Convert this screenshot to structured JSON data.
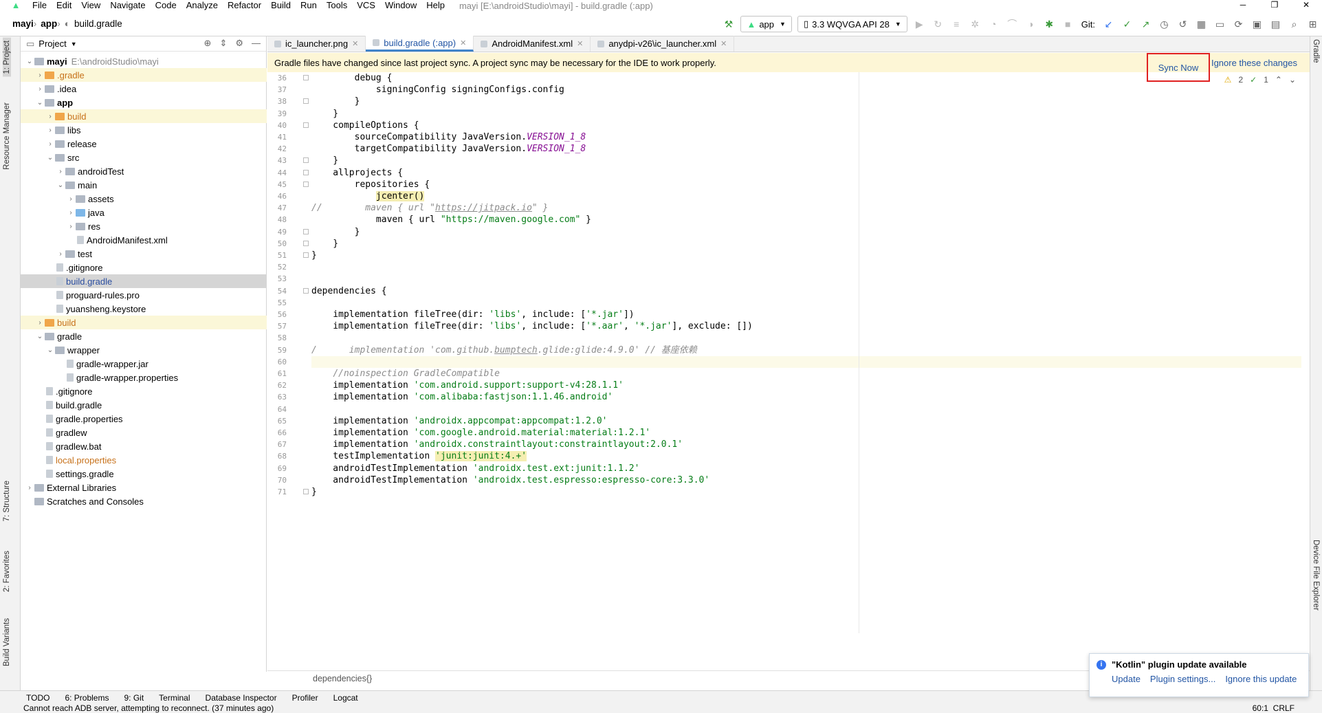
{
  "menu": {
    "items": [
      "File",
      "Edit",
      "View",
      "Navigate",
      "Code",
      "Analyze",
      "Refactor",
      "Build",
      "Run",
      "Tools",
      "VCS",
      "Window",
      "Help"
    ],
    "window_title": "mayi [E:\\androidStudio\\mayi] - build.gradle (:app)"
  },
  "breadcrumb": {
    "project": "mayi",
    "module": "app",
    "file": "build.gradle"
  },
  "toolbar": {
    "config": "app",
    "device": "3.3  WQVGA API 28",
    "git": "Git:"
  },
  "left_tabs": [
    "1: Project",
    "Resource Manager",
    "7: Structure",
    "2: Favorites",
    "Build Variants"
  ],
  "right_tabs": [
    "Gradle",
    "Device File Explorer"
  ],
  "project_panel": {
    "title": "Project"
  },
  "tree": [
    {
      "label": "mayi",
      "sec": "E:\\androidStudio\\mayi",
      "depth": 0,
      "arrow": "v",
      "icon": "fold",
      "bold": true
    },
    {
      "label": ".gradle",
      "depth": 1,
      "arrow": ">",
      "icon": "foldo",
      "cls": "orange",
      "hl": true
    },
    {
      "label": ".idea",
      "depth": 1,
      "arrow": ">",
      "icon": "fold"
    },
    {
      "label": "app",
      "depth": 1,
      "arrow": "v",
      "icon": "fold",
      "bold": true
    },
    {
      "label": "build",
      "depth": 2,
      "arrow": ">",
      "icon": "foldo",
      "cls": "orange",
      "hl": true
    },
    {
      "label": "libs",
      "depth": 2,
      "arrow": ">",
      "icon": "fold"
    },
    {
      "label": "release",
      "depth": 2,
      "arrow": ">",
      "icon": "fold"
    },
    {
      "label": "src",
      "depth": 2,
      "arrow": "v",
      "icon": "fold"
    },
    {
      "label": "androidTest",
      "depth": 3,
      "arrow": ">",
      "icon": "fold"
    },
    {
      "label": "main",
      "depth": 3,
      "arrow": "v",
      "icon": "fold"
    },
    {
      "label": "assets",
      "depth": 4,
      "arrow": ">",
      "icon": "fold"
    },
    {
      "label": "java",
      "depth": 4,
      "arrow": ">",
      "icon": "foldb"
    },
    {
      "label": "res",
      "depth": 4,
      "arrow": ">",
      "icon": "fold"
    },
    {
      "label": "AndroidManifest.xml",
      "depth": 4,
      "arrow": "",
      "icon": "file"
    },
    {
      "label": "test",
      "depth": 3,
      "arrow": ">",
      "icon": "fold"
    },
    {
      "label": ".gitignore",
      "depth": 2,
      "arrow": "",
      "icon": "file"
    },
    {
      "label": "build.gradle",
      "depth": 2,
      "arrow": "",
      "icon": "file",
      "cls": "blue",
      "sel": true
    },
    {
      "label": "proguard-rules.pro",
      "depth": 2,
      "arrow": "",
      "icon": "file"
    },
    {
      "label": "yuansheng.keystore",
      "depth": 2,
      "arrow": "",
      "icon": "file"
    },
    {
      "label": "build",
      "depth": 1,
      "arrow": ">",
      "icon": "foldo",
      "cls": "orange",
      "hl": true
    },
    {
      "label": "gradle",
      "depth": 1,
      "arrow": "v",
      "icon": "fold"
    },
    {
      "label": "wrapper",
      "depth": 2,
      "arrow": "v",
      "icon": "fold"
    },
    {
      "label": "gradle-wrapper.jar",
      "depth": 3,
      "arrow": "",
      "icon": "file"
    },
    {
      "label": "gradle-wrapper.properties",
      "depth": 3,
      "arrow": "",
      "icon": "file"
    },
    {
      "label": ".gitignore",
      "depth": 1,
      "arrow": "",
      "icon": "file"
    },
    {
      "label": "build.gradle",
      "depth": 1,
      "arrow": "",
      "icon": "file"
    },
    {
      "label": "gradle.properties",
      "depth": 1,
      "arrow": "",
      "icon": "file"
    },
    {
      "label": "gradlew",
      "depth": 1,
      "arrow": "",
      "icon": "file"
    },
    {
      "label": "gradlew.bat",
      "depth": 1,
      "arrow": "",
      "icon": "file"
    },
    {
      "label": "local.properties",
      "depth": 1,
      "arrow": "",
      "icon": "file",
      "cls": "orange"
    },
    {
      "label": "settings.gradle",
      "depth": 1,
      "arrow": "",
      "icon": "file"
    },
    {
      "label": "External Libraries",
      "depth": 0,
      "arrow": ">",
      "icon": "fold"
    },
    {
      "label": "Scratches and Consoles",
      "depth": 0,
      "arrow": "",
      "icon": "fold"
    }
  ],
  "tabs": [
    {
      "label": "ic_launcher.png",
      "active": false
    },
    {
      "label": "build.gradle (:app)",
      "active": true
    },
    {
      "label": "AndroidManifest.xml",
      "active": false
    },
    {
      "label": "anydpi-v26\\ic_launcher.xml",
      "active": false
    }
  ],
  "banner": {
    "message": "Gradle files have changed since last project sync. A project sync may be necessary for the IDE to work properly.",
    "sync": "Sync Now",
    "ignore": "Ignore these changes"
  },
  "inspections": {
    "warnings": "2",
    "checks": "1"
  },
  "code": [
    {
      "n": "36",
      "html": "        debug {"
    },
    {
      "n": "37",
      "html": "            signingConfig signingConfigs.config"
    },
    {
      "n": "38",
      "html": "        }"
    },
    {
      "n": "39",
      "html": "    }"
    },
    {
      "n": "40",
      "html": "    compileOptions {"
    },
    {
      "n": "41",
      "html": "        sourceCompatibility JavaVersion.<span class='ital'>VERSION_1_8</span>"
    },
    {
      "n": "42",
      "html": "        targetCompatibility JavaVersion.<span class='ital'>VERSION_1_8</span>"
    },
    {
      "n": "43",
      "html": "    }"
    },
    {
      "n": "44",
      "html": "    allprojects {"
    },
    {
      "n": "45",
      "html": "        repositories {"
    },
    {
      "n": "46",
      "html": "            <span class='hlw'>jcenter()</span>"
    },
    {
      "n": "47",
      "html": "<span class='cmt'>//        maven { url \"<u>https://jitpack.io</u>\" }</span>"
    },
    {
      "n": "48",
      "html": "            maven { url <span class='str'>\"https://maven.google.com\"</span> }"
    },
    {
      "n": "49",
      "html": "        }"
    },
    {
      "n": "50",
      "html": "    }"
    },
    {
      "n": "51",
      "html": "}"
    },
    {
      "n": "52",
      "html": ""
    },
    {
      "n": "53",
      "html": ""
    },
    {
      "n": "54",
      "html": "dependencies {"
    },
    {
      "n": "55",
      "html": ""
    },
    {
      "n": "56",
      "html": "    implementation fileTree(dir: <span class='str'>'libs'</span>, include: [<span class='str'>'*.jar'</span>])"
    },
    {
      "n": "57",
      "html": "    implementation fileTree(dir: <span class='str'>'libs'</span>, include: [<span class='str'>'*.aar'</span>, <span class='str'>'*.jar'</span>], exclude: [])"
    },
    {
      "n": "58",
      "html": ""
    },
    {
      "n": "59",
      "html": "<span class='cmt'>/      implementation 'com.github.<u>bumptech</u>.glide:glide:4.9.0' // 基座依赖</span>"
    },
    {
      "n": "60",
      "html": ""
    },
    {
      "n": "61",
      "html": "    <span class='cmt'>//noinspection GradleCompatible</span>"
    },
    {
      "n": "62",
      "html": "    implementation <span class='str'>'com.android.support:support-v4:28.1.1'</span>"
    },
    {
      "n": "63",
      "html": "    implementation <span class='str'>'com.alibaba:fastjson:1.1.46.android'</span>"
    },
    {
      "n": "64",
      "html": ""
    },
    {
      "n": "65",
      "html": "    implementation <span class='str'>'androidx.appcompat:appcompat:1.2.0'</span>"
    },
    {
      "n": "66",
      "html": "    implementation <span class='str'>'com.google.android.material:material:1.2.1'</span>"
    },
    {
      "n": "67",
      "html": "    implementation <span class='str'>'androidx.constraintlayout:constraintlayout:2.0.1'</span>"
    },
    {
      "n": "68",
      "html": "    testImplementation <span class='strhl'>'junit:junit:4.+'</span>"
    },
    {
      "n": "69",
      "html": "    androidTestImplementation <span class='str'>'androidx.test.ext:junit:1.1.2'</span>"
    },
    {
      "n": "70",
      "html": "    androidTestImplementation <span class='str'>'androidx.test.espresso:espresso-core:3.3.0'</span>"
    },
    {
      "n": "71",
      "html": "}"
    }
  ],
  "breadcrumb_bottom": "dependencies{}",
  "bottom_tabs": [
    "TODO",
    "6: Problems",
    "9: Git",
    "Terminal",
    "Database Inspector",
    "Profiler",
    "Logcat"
  ],
  "status": {
    "message": "Cannot reach ADB server, attempting to reconnect. (37 minutes ago)",
    "position": "60:1",
    "eol": "CRLF"
  },
  "notification": {
    "title": "\"Kotlin\" plugin update available",
    "links": [
      "Update",
      "Plugin settings...",
      "Ignore this update"
    ]
  }
}
